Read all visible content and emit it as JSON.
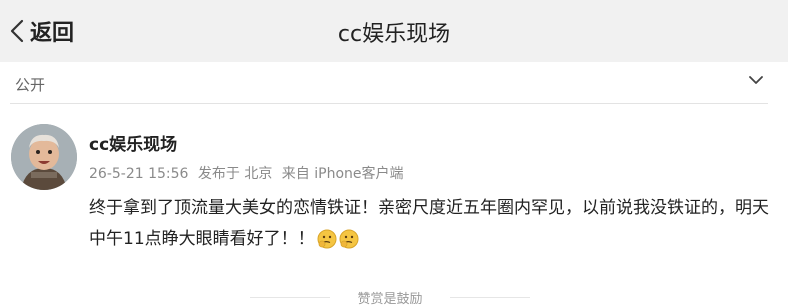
{
  "header": {
    "back_label": "返回",
    "title": "cc娱乐现场"
  },
  "visibility": {
    "label": "公开"
  },
  "post": {
    "author": "cc娱乐现场",
    "time": "26-5-21 15:56",
    "location": "发布于 北京",
    "source": "来自 iPhone客户端",
    "text": "终于拿到了顶流量大美女的恋情铁证！亲密尺度近五年圈内罕见，以前说我没铁证的，明天中午11点睁大眼睛看好了！！",
    "emojis": [
      "thinking-face-icon",
      "thinking-face-icon"
    ]
  },
  "footer": {
    "hint": "赞赏是鼓励"
  }
}
